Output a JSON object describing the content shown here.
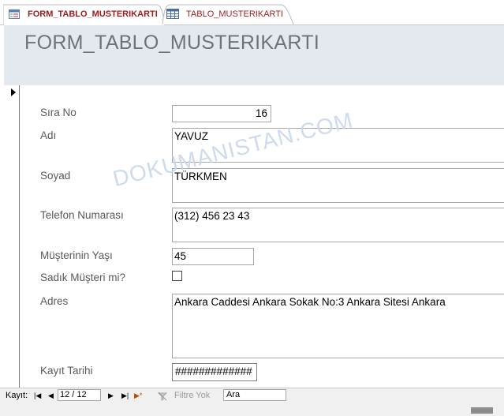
{
  "tabs": [
    {
      "label": "FORM_TABLO_MUSTERIKARTI",
      "icon": "form-icon",
      "active": true,
      "color": "#9b1c1c"
    },
    {
      "label": "TABLO_MUSTERIKARTI",
      "icon": "table-icon",
      "active": false,
      "color": "#9b1c1c"
    }
  ],
  "form": {
    "title": "FORM_TABLO_MUSTERIKARTI",
    "fields": {
      "sira_no": {
        "label": "Sıra No",
        "value": "16"
      },
      "adi": {
        "label": "Adı",
        "value": "YAVUZ"
      },
      "soyad": {
        "label": "Soyad",
        "value": "TÜRKMEN"
      },
      "telefon": {
        "label": "Telefon Numarası",
        "value": "(312) 456 23 43"
      },
      "yas": {
        "label": "Müşterinin Yaşı",
        "value": "45"
      },
      "sadik": {
        "label": "Sadık Müşteri mi?",
        "checked": false
      },
      "adres": {
        "label": "Adres",
        "value": "Ankara Caddesi Ankara Sokak No:3 Ankara Sitesi Ankara"
      },
      "kayit_tarihi": {
        "label": "Kayıt Tarihi",
        "value": "#############"
      }
    }
  },
  "watermark": "DOKUMANISTAN.COM",
  "navigation": {
    "label": "Kayıt:",
    "first_glyph": "|◀",
    "prev_glyph": "◀",
    "record": "12 / 12",
    "next_glyph": "▶",
    "last_glyph": "▶|",
    "new_glyph": "▶*",
    "filter_label": "Filtre Yok",
    "search_value": "Ara"
  },
  "colors": {
    "header_bg": "#e4e8ef",
    "title_color": "#6f7378",
    "label_color": "#595959",
    "tab_text": "#9b1c1c"
  }
}
